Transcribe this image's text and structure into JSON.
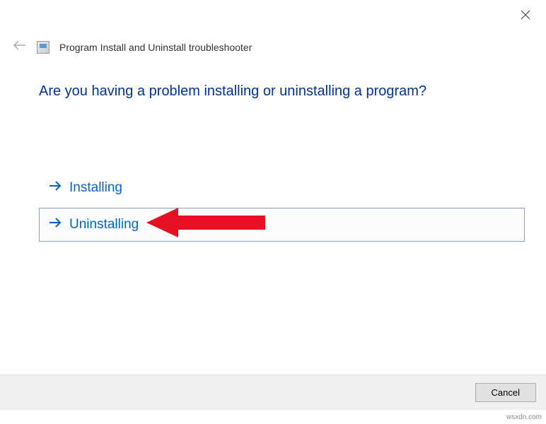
{
  "window": {
    "title": "Program Install and Uninstall troubleshooter"
  },
  "main": {
    "question": "Are you having a problem installing or uninstalling a program?",
    "options": [
      {
        "label": "Installing",
        "selected": false
      },
      {
        "label": "Uninstalling",
        "selected": true
      }
    ]
  },
  "footer": {
    "cancel_label": "Cancel"
  },
  "watermark": "wsxdn.com"
}
